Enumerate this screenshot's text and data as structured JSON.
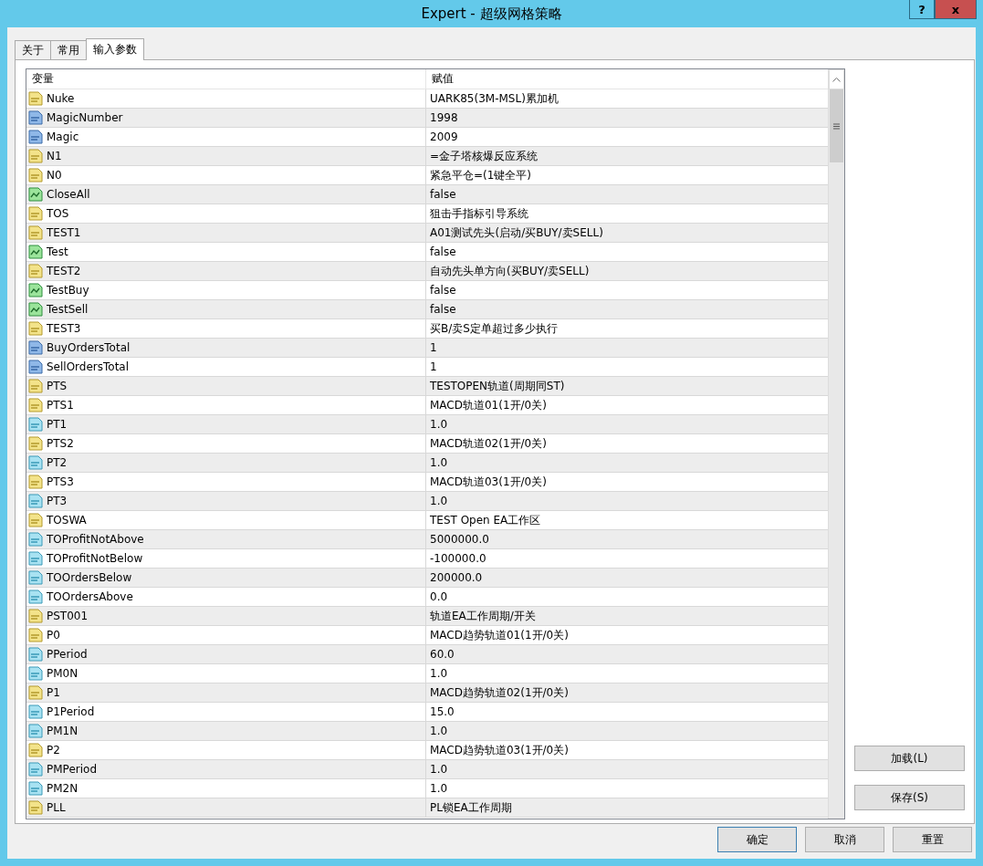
{
  "window": {
    "title": "Expert - 超级网格策略",
    "help_button": "?",
    "close_button": "x"
  },
  "tabs": [
    {
      "label": "关于",
      "selected": false
    },
    {
      "label": "常用",
      "selected": false
    },
    {
      "label": "输入参数",
      "selected": true
    }
  ],
  "table": {
    "columns": [
      "变量",
      "赋值"
    ],
    "rows": [
      {
        "kind": "string",
        "name": "Nuke",
        "value": "UARK85(3M-MSL)累加机"
      },
      {
        "kind": "int",
        "name": "MagicNumber",
        "value": "1998"
      },
      {
        "kind": "int",
        "name": "Magic",
        "value": "2009"
      },
      {
        "kind": "string",
        "name": "N1",
        "value": "=金子塔核爆反应系统"
      },
      {
        "kind": "string",
        "name": "N0",
        "value": "紧急平仓=(1键全平)"
      },
      {
        "kind": "bool",
        "name": "CloseAll",
        "value": "false"
      },
      {
        "kind": "string",
        "name": "TOS",
        "value": "狙击手指标引导系统"
      },
      {
        "kind": "string",
        "name": "TEST1",
        "value": "A01测试先头(启动/买BUY/卖SELL)"
      },
      {
        "kind": "bool",
        "name": "Test",
        "value": "false"
      },
      {
        "kind": "string",
        "name": "TEST2",
        "value": "自动先头单方向(买BUY/卖SELL)"
      },
      {
        "kind": "bool",
        "name": "TestBuy",
        "value": "false"
      },
      {
        "kind": "bool",
        "name": "TestSell",
        "value": "false"
      },
      {
        "kind": "string",
        "name": "TEST3",
        "value": "买B/卖S定单超过多少执行"
      },
      {
        "kind": "int",
        "name": "BuyOrdersTotal",
        "value": "1"
      },
      {
        "kind": "int",
        "name": "SellOrdersTotal",
        "value": "1"
      },
      {
        "kind": "string",
        "name": "PTS",
        "value": "TESTOPEN轨道(周期同ST)"
      },
      {
        "kind": "string",
        "name": "PTS1",
        "value": "MACD轨道01(1开/0关)"
      },
      {
        "kind": "double",
        "name": "PT1",
        "value": "1.0"
      },
      {
        "kind": "string",
        "name": "PTS2",
        "value": "MACD轨道02(1开/0关)"
      },
      {
        "kind": "double",
        "name": "PT2",
        "value": "1.0"
      },
      {
        "kind": "string",
        "name": "PTS3",
        "value": "MACD轨道03(1开/0关)"
      },
      {
        "kind": "double",
        "name": "PT3",
        "value": "1.0"
      },
      {
        "kind": "string",
        "name": "TOSWA",
        "value": "TEST Open EA工作区"
      },
      {
        "kind": "double",
        "name": "TOProfitNotAbove",
        "value": "5000000.0"
      },
      {
        "kind": "double",
        "name": "TOProfitNotBelow",
        "value": "-100000.0"
      },
      {
        "kind": "double",
        "name": "TOOrdersBelow",
        "value": "200000.0"
      },
      {
        "kind": "double",
        "name": "TOOrdersAbove",
        "value": "0.0"
      },
      {
        "kind": "string",
        "name": "PST001",
        "value": "轨道EA工作周期/开关"
      },
      {
        "kind": "string",
        "name": "P0",
        "value": "MACD趋势轨道01(1开/0关)"
      },
      {
        "kind": "double",
        "name": "PPeriod",
        "value": "60.0"
      },
      {
        "kind": "double",
        "name": "PM0N",
        "value": "1.0"
      },
      {
        "kind": "string",
        "name": "P1",
        "value": "MACD趋势轨道02(1开/0关)"
      },
      {
        "kind": "double",
        "name": "P1Period",
        "value": "15.0"
      },
      {
        "kind": "double",
        "name": "PM1N",
        "value": "1.0"
      },
      {
        "kind": "string",
        "name": "P2",
        "value": "MACD趋势轨道03(1开/0关)"
      },
      {
        "kind": "double",
        "name": "PMPeriod",
        "value": "1.0"
      },
      {
        "kind": "double",
        "name": "PM2N",
        "value": "1.0"
      },
      {
        "kind": "string",
        "name": "PLL",
        "value": "PL锁EA工作周期"
      }
    ]
  },
  "side_buttons": [
    {
      "label": "加载(L)"
    },
    {
      "label": "保存(S)"
    }
  ],
  "dialog_buttons": [
    {
      "label": "确定",
      "default": true
    },
    {
      "label": "取消",
      "default": false
    },
    {
      "label": "重置",
      "default": false
    }
  ]
}
